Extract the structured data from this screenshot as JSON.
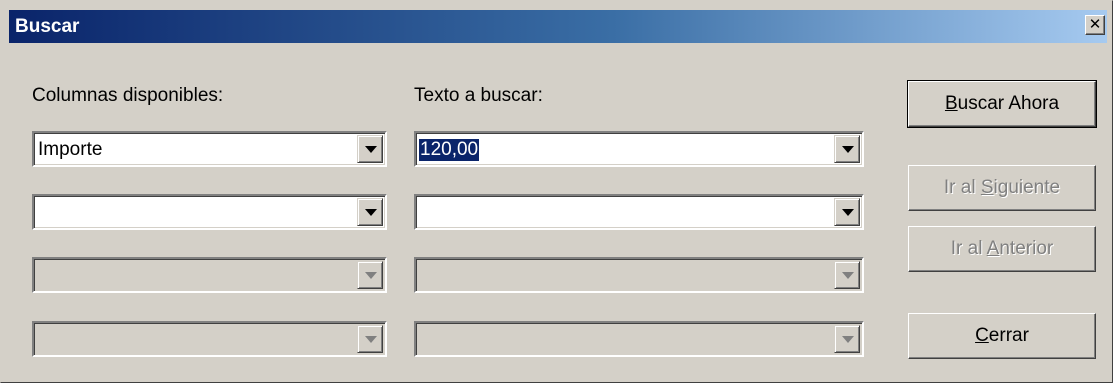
{
  "window": {
    "title": "Buscar"
  },
  "labels": {
    "columns": "Columnas disponibles:",
    "search_text": "Texto a buscar:"
  },
  "rows": [
    {
      "column": "Importe",
      "text": "120,00",
      "enabled": true
    },
    {
      "column": "",
      "text": "",
      "enabled": true
    },
    {
      "column": "",
      "text": "",
      "enabled": false
    },
    {
      "column": "",
      "text": "",
      "enabled": false
    }
  ],
  "buttons": {
    "search_now": {
      "pre": "",
      "key": "B",
      "post": "uscar Ahora",
      "enabled": true
    },
    "go_next": {
      "pre": "Ir al ",
      "key": "S",
      "post": "iguiente",
      "enabled": false
    },
    "go_prev": {
      "pre": "Ir al ",
      "key": "A",
      "post": "nterior",
      "enabled": false
    },
    "close": {
      "pre": "",
      "key": "C",
      "post": "errar",
      "enabled": true
    }
  },
  "icons": {
    "close": "close-icon",
    "dropdown": "chevron-down-icon"
  }
}
